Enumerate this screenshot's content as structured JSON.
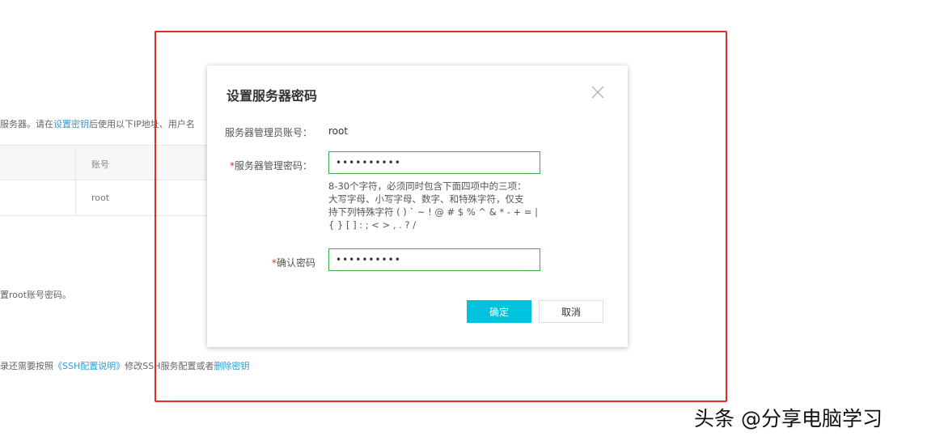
{
  "background": {
    "intro_before": "服务器。请在",
    "intro_link": "设置密钥",
    "intro_after": "后使用以下IP地址、用户名",
    "table": {
      "header": "账号",
      "row_value": "root"
    },
    "note": "置root账号密码。",
    "ssh_before": "录还需要按照",
    "ssh_link": "《SSH配置说明》",
    "ssh_middle": "修改SSH服务配置或者",
    "ssh_link2": "删除密钥"
  },
  "dialog": {
    "title": "设置服务器密码",
    "close_icon": "close-icon",
    "account_label": "服务器管理员账号：",
    "account_value": "root",
    "password_label": "服务器管理密码：",
    "password_value": "••••••••••",
    "required_mark": "*",
    "hint_lines": [
      "8-30个字符，必须同时包含下面四项中的三项：",
      "大写字母、小写字母、数字、和特殊字符，仅支",
      "持下列特殊字符 ( ) ` ~ ! @ # $ % ^ & * - + = |",
      "{ } [ ] : ; < > , . ? /"
    ],
    "confirm_label": "确认密码",
    "confirm_value": "••••••••••",
    "ok_label": "确定",
    "cancel_label": "取消"
  },
  "colors": {
    "accent": "#00c1de",
    "link": "#27a0d1",
    "input_border": "#3cae4a",
    "highlight_frame": "#e02e24"
  },
  "watermark": "头条 @分享电脑学习"
}
